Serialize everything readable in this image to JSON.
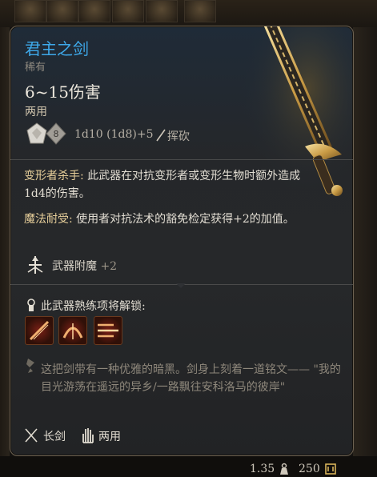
{
  "item": {
    "name": "君主之剑",
    "rarity": "稀有",
    "damage": "6~15伤害",
    "handedness": "两用",
    "dice": [
      "d10",
      "d8"
    ],
    "roll": "1d10 (1d8)+5",
    "damage_type": "挥砍"
  },
  "passives": [
    {
      "keyword": "变形者杀手:",
      "text": " 此武器在对抗变形者或变形生物时额外造成1d4的伤害。"
    },
    {
      "keyword": "魔法耐受:",
      "text": " 使用者对抗法术的豁免检定获得+2的加值。"
    }
  ],
  "enchantment": {
    "label": "武器附魔",
    "bonus": "+2"
  },
  "proficiency": {
    "label": "此武器熟练项将解锁:",
    "actions": [
      "slash-action-icon",
      "cleave-action-icon",
      "rush-action-icon"
    ]
  },
  "lore": "这把剑带有一种优雅的暗黑。剑身上刻着一道铭文—— \"我的目光游荡在遥远的异乡/一路飘往安科洛马的彼岸\"",
  "properties": [
    {
      "icon": "longsword-icon",
      "label": "长剑"
    },
    {
      "icon": "versatile-hand-icon",
      "label": "两用"
    }
  ],
  "footer": {
    "weight": "1.35",
    "value": "250"
  },
  "colors": {
    "title": "#3ea9ea",
    "keyword": "#e7cf9a",
    "lore": "#8e877b",
    "panel_border": "#6d6252"
  }
}
